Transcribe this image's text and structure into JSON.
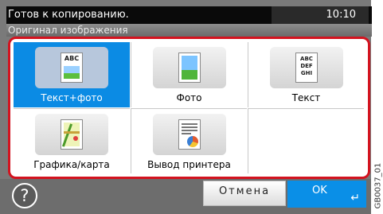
{
  "status": {
    "title": "Готов к копированию.",
    "time": "10:10"
  },
  "subtitle": "Оригинал изображения",
  "options": [
    {
      "label": "Текст+фото",
      "icon": "text-photo-icon",
      "icon_text": "ABC",
      "selected": true
    },
    {
      "label": "Фото",
      "icon": "photo-icon",
      "selected": false
    },
    {
      "label": "Текст",
      "icon": "text-icon",
      "icon_text": "ABC DEF GHI",
      "selected": false
    },
    {
      "label": "Графика/карта",
      "icon": "map-icon",
      "selected": false
    },
    {
      "label": "Вывод принтера",
      "icon": "printer-output-icon",
      "selected": false
    }
  ],
  "buttons": {
    "help": "?",
    "cancel": "Отмена",
    "ok": "OK",
    "enter_glyph": "↵"
  },
  "doc_code": "GB0037_01",
  "colors": {
    "accent_blue": "#0b8be4",
    "frame_red": "#d3131f"
  }
}
